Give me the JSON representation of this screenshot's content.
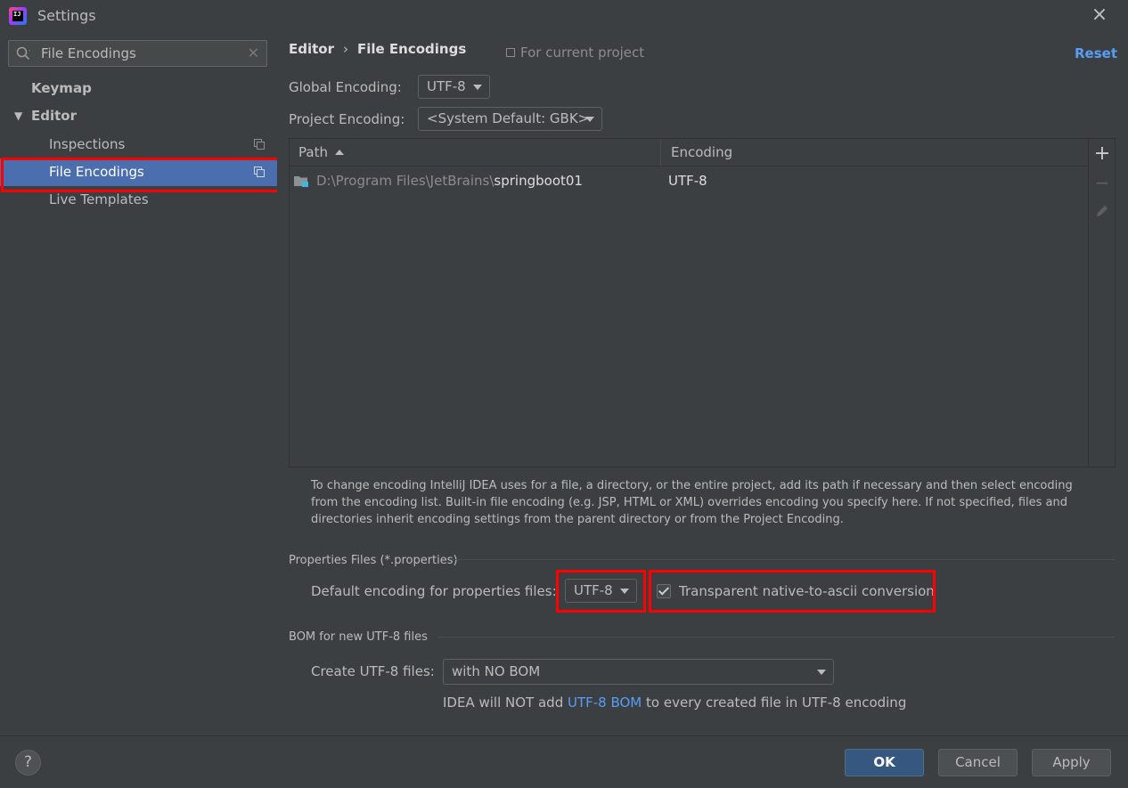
{
  "window": {
    "title": "Settings",
    "app_icon_text": "IJ",
    "close_icon": "×"
  },
  "sidebar": {
    "search": {
      "value": "File Encodings",
      "clear_icon": "✕"
    },
    "items": [
      {
        "label": "Keymap",
        "bold": true
      },
      {
        "label": "Editor",
        "bold": true,
        "expanded": true,
        "arrow": "▼"
      },
      {
        "label": "Inspections"
      },
      {
        "label": "File Encodings",
        "selected": true
      },
      {
        "label": "Live Templates"
      }
    ]
  },
  "header": {
    "breadcrumb": [
      "Editor",
      "File Encodings"
    ],
    "breadcrumb_sep": "›",
    "scope": "For current project",
    "reset": "Reset"
  },
  "form": {
    "global_label": "Global Encoding:",
    "global_value": "UTF-8",
    "project_label": "Project Encoding:",
    "project_value": "<System Default: GBK>"
  },
  "table": {
    "columns": [
      "Path",
      "Encoding"
    ],
    "rows": [
      {
        "path_prefix": "D:\\Program Files\\JetBrains\\",
        "path_tail": "springboot01",
        "encoding": "UTF-8"
      }
    ],
    "toolbar": {
      "add": "+",
      "remove": "−"
    }
  },
  "help_text": "To change encoding IntelliJ IDEA uses for a file, a directory, or the entire project, add its path if necessary and then select encoding from the encoding list. Built-in file encoding (e.g. JSP, HTML or XML) overrides encoding you specify here. If not specified, files and directories inherit encoding settings from the parent directory or from the Project Encoding.",
  "properties": {
    "section_title": "Properties Files (*.properties)",
    "default_label": "Default encoding for properties files:",
    "default_value": "UTF-8",
    "native_ascii_label": "Transparent native-to-ascii conversion",
    "native_ascii_checked": true
  },
  "bom": {
    "section_title": "BOM for new UTF-8 files",
    "create_label": "Create UTF-8 files:",
    "create_value": "with NO BOM",
    "note_before": "IDEA will NOT add ",
    "note_link": "UTF-8 BOM",
    "note_after": " to every created file in UTF-8 encoding"
  },
  "footer": {
    "help": "?",
    "ok": "OK",
    "cancel": "Cancel",
    "apply": "Apply"
  },
  "colors": {
    "background": "#3c3f41",
    "selection": "#4b6eaf",
    "highlight": "#ff0000",
    "link": "#589df6",
    "primary_button": "#365880"
  }
}
